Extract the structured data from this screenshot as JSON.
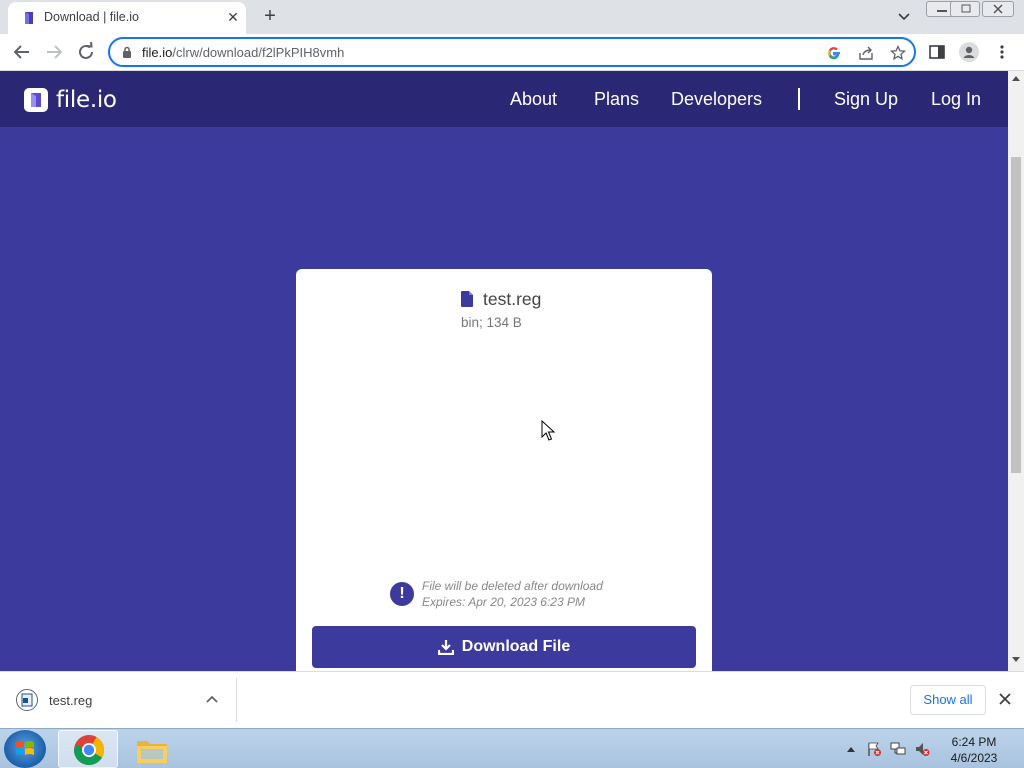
{
  "browser": {
    "tab": {
      "title": "Download | file.io"
    },
    "url": {
      "host": "file.io",
      "path": "/clrw/download/f2lPkPIH8vmh"
    }
  },
  "site": {
    "logo_text": "file.io",
    "nav": {
      "about": "About",
      "plans": "Plans",
      "developers": "Developers",
      "sign_up": "Sign Up",
      "log_in": "Log In"
    }
  },
  "card": {
    "file_name": "test.reg",
    "file_meta": "bin; 134 B",
    "warning_line1": "File will be deleted after download",
    "warning_line2": "Expires: Apr 20, 2023 6:23 PM",
    "download_label": "Download File"
  },
  "download_shelf": {
    "file_name": "test.reg",
    "show_all_label": "Show all"
  },
  "taskbar": {
    "time": "6:24 PM",
    "date": "4/6/2023"
  },
  "colors": {
    "page_bg": "#3c3a9c",
    "nav_bg": "#2a2875",
    "accent": "#3c3a9c",
    "omnibox_focus": "#1a73e8"
  }
}
